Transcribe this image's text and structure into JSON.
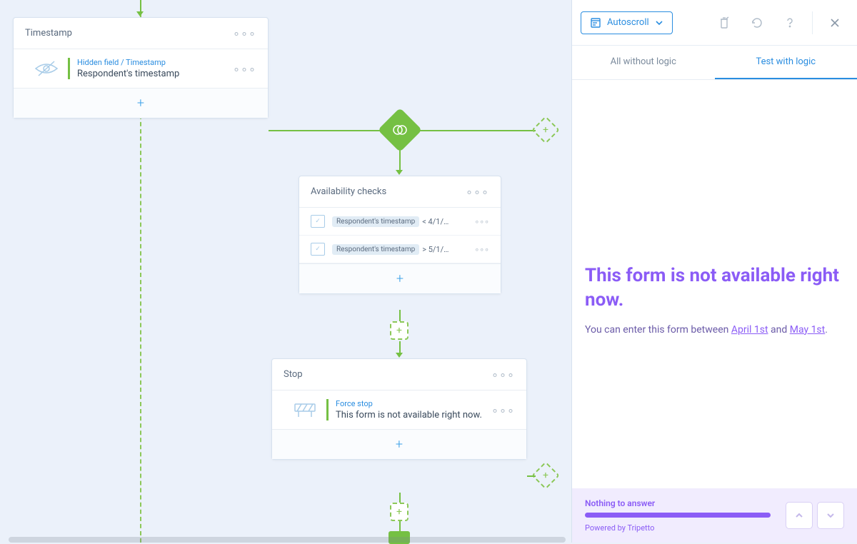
{
  "nodes": {
    "timestamp": {
      "title": "Timestamp",
      "subtitle": "Hidden field / Timestamp",
      "text": "Respondent's timestamp"
    },
    "availability": {
      "title": "Availability checks",
      "conditions": [
        {
          "pill": "Respondent's timestamp",
          "op": "< 4/1/…"
        },
        {
          "pill": "Respondent's timestamp",
          "op": "> 5/1/…"
        }
      ]
    },
    "stop": {
      "title": "Stop",
      "subtitle": "Force stop",
      "text": "This form is not available right now."
    }
  },
  "toolbar": {
    "autoscroll": "Autoscroll"
  },
  "tabs": {
    "all": "All without logic",
    "test": "Test with logic"
  },
  "preview": {
    "title": "This form is not available right now.",
    "subtext_prefix": "You can enter this form between ",
    "link1": "April 1st",
    "and": " and ",
    "link2": "May 1st",
    "suffix": "."
  },
  "footer": {
    "nothing": "Nothing to answer",
    "powered": "Powered by Tripetto"
  }
}
